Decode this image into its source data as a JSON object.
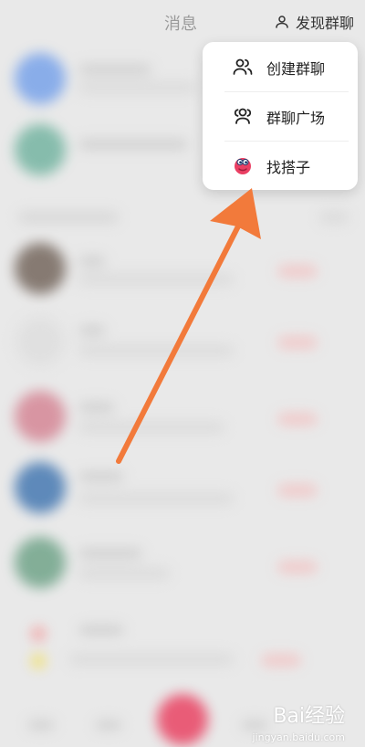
{
  "header": {
    "title": "消息",
    "discover_label": "发现群聊"
  },
  "popup": {
    "items": [
      {
        "label": "创建群聊",
        "icon": "create-group-icon"
      },
      {
        "label": "群聊广场",
        "icon": "group-square-icon"
      },
      {
        "label": "找搭子",
        "icon": "find-buddy-icon"
      }
    ]
  },
  "colors": {
    "arrow": "#f27a3b",
    "popup_bg": "#ffffff",
    "text_primary": "#222222",
    "text_muted": "#9a9a9a"
  },
  "watermark": {
    "brand": "Bai经验",
    "site": "jingyan.baidu.com"
  }
}
